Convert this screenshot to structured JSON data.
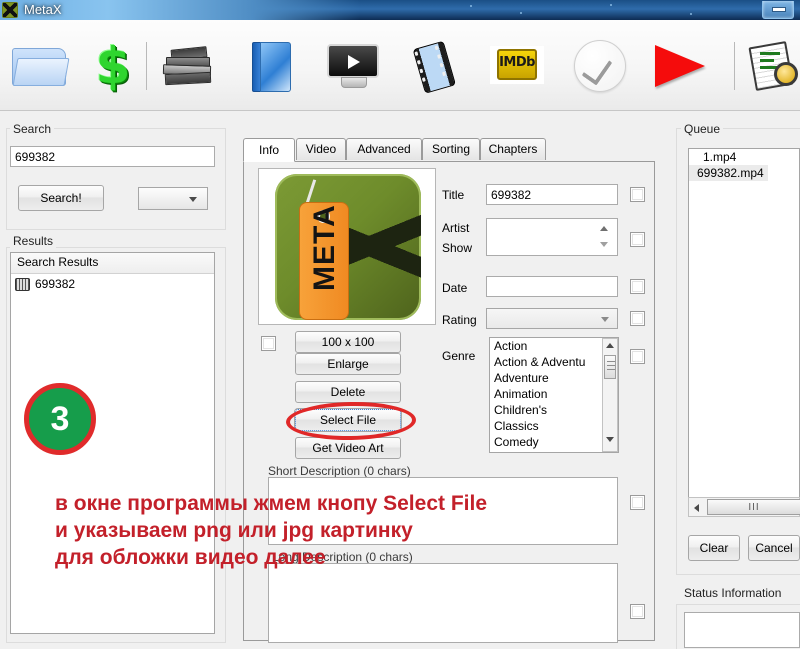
{
  "window": {
    "title": "MetaX",
    "app_icon": "metax-app-icon",
    "minimize_label": "Minimize"
  },
  "toolbar": {
    "buttons": [
      {
        "name": "open-folder",
        "icon": "folder-icon"
      },
      {
        "name": "purchase",
        "icon": "dollar-icon"
      },
      {
        "name": "books",
        "icon": "books-icon"
      },
      {
        "name": "book",
        "icon": "blue-book-icon"
      },
      {
        "name": "video",
        "icon": "video-monitor-icon"
      },
      {
        "name": "film",
        "icon": "film-strip-icon"
      },
      {
        "name": "imdb",
        "icon": "imdb-icon",
        "label": "IMDb"
      },
      {
        "name": "verify",
        "icon": "check-circle-icon"
      },
      {
        "name": "write-tags",
        "icon": "red-play-arrow-icon"
      },
      {
        "name": "spreadsheet",
        "icon": "spreadsheet-search-icon"
      }
    ]
  },
  "search_panel": {
    "legend": "Search",
    "query_value": "699382",
    "search_button": "Search!",
    "source_selected": "",
    "source_caret": "chevron-down-icon"
  },
  "results_panel": {
    "legend": "Results",
    "column_header": "Search Results",
    "rows": [
      {
        "icon": "film-reel-icon",
        "label": "699382"
      }
    ]
  },
  "center_panel": {
    "tabs": [
      {
        "label": "Info",
        "selected": true
      },
      {
        "label": "Video",
        "selected": false
      },
      {
        "label": "Advanced",
        "selected": false
      },
      {
        "label": "Sorting",
        "selected": false
      },
      {
        "label": "Chapters",
        "selected": false
      }
    ],
    "artwork": {
      "alt": "MetaX logo artwork",
      "size_label": "100 x 100"
    },
    "art_buttons": [
      {
        "label": "Enlarge",
        "name": "enlarge-button"
      },
      {
        "label": "Delete",
        "name": "delete-button"
      },
      {
        "label": "Select File",
        "name": "select-file-button"
      },
      {
        "label": "Get Video Art",
        "name": "get-video-art-button"
      }
    ],
    "fields": [
      {
        "label": "Title",
        "value": "699382",
        "type": "text"
      },
      {
        "label": "Artist",
        "label2": "Show",
        "value": "",
        "type": "spinner"
      },
      {
        "label": "Date",
        "value": "",
        "type": "text"
      },
      {
        "label": "Rating",
        "value": "",
        "type": "combo"
      }
    ],
    "genre": {
      "label": "Genre",
      "options": [
        "Action",
        "Action & Adventu",
        "Adventure",
        "Animation",
        "Children's",
        "Classics",
        "Comedy"
      ]
    },
    "short_description": {
      "label": "Short Description (0 chars)",
      "value": ""
    },
    "long_description": {
      "label": "Long Description (0 chars)",
      "value": ""
    }
  },
  "queue_panel": {
    "legend": "Queue",
    "items": [
      {
        "label": "1.mp4",
        "selected": false
      },
      {
        "label": "699382.mp4",
        "selected": true
      }
    ],
    "hscroll": {
      "left_arrow": "caret-left-icon",
      "thumb_glyph": "III"
    },
    "buttons": [
      {
        "label": "Clear",
        "name": "clear-button"
      },
      {
        "label": "Cancel",
        "name": "cancel-button"
      }
    ]
  },
  "status_panel": {
    "legend": "Status Information",
    "value": ""
  },
  "annotation": {
    "step_number": "3",
    "text": "в окне программы жмем кнопу Select File\nи указываем png или jpg картинку\nдля обложки видео далее",
    "highlight_target": "Select File"
  },
  "colors": {
    "annotation_red": "#c3202a",
    "step_green": "#169d4b",
    "step_border_red": "#e02b2b",
    "titlebar_blue": "#2f6cab",
    "panel_bg": "#f0f0f0"
  }
}
